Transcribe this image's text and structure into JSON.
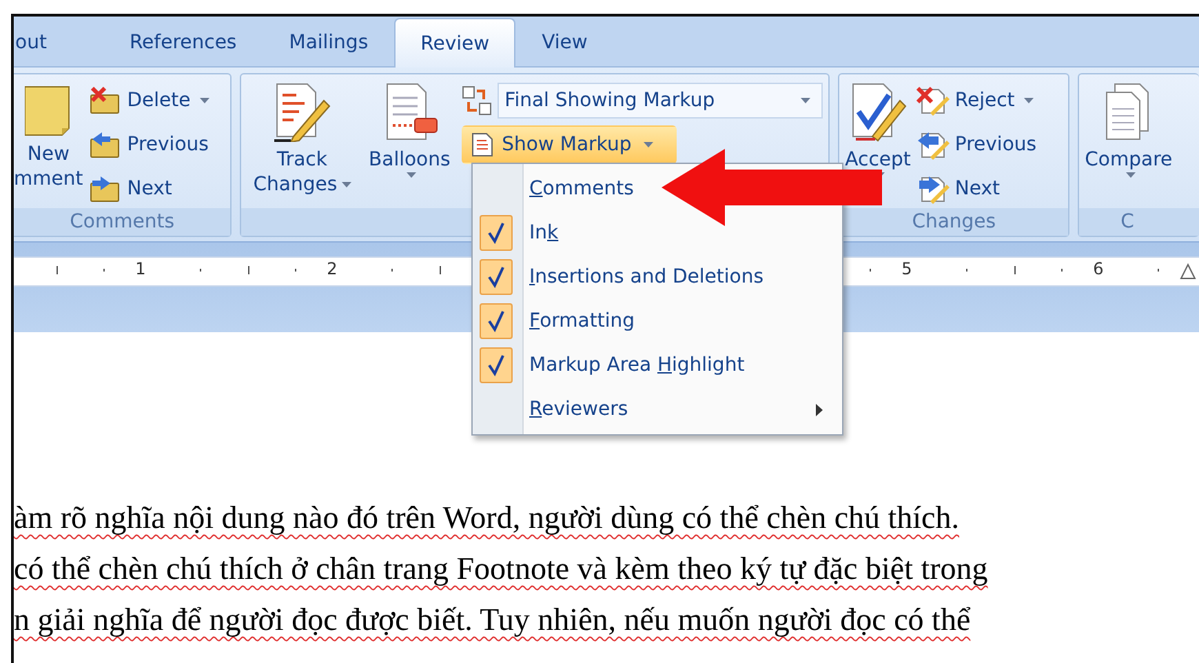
{
  "tabs": [
    {
      "label": "out",
      "selected": false
    },
    {
      "label": "References",
      "selected": false
    },
    {
      "label": "Mailings",
      "selected": false
    },
    {
      "label": "Review",
      "selected": true
    },
    {
      "label": "View",
      "selected": false
    }
  ],
  "comments_group": {
    "label": "Comments",
    "new_comment": {
      "label": "New\nmment"
    },
    "delete": {
      "label": "Delete",
      "dropdown": true
    },
    "previous": {
      "label": "Previous"
    },
    "next": {
      "label": "Next"
    }
  },
  "tracking_group": {
    "track_changes": {
      "label": "Track\nChanges",
      "dropdown": true
    },
    "balloons": {
      "label": "Balloons",
      "dropdown": true
    },
    "display_combo": {
      "value": "Final Showing Markup"
    },
    "show_markup": {
      "label": "Show Markup",
      "dropdown": true,
      "pressed": true
    }
  },
  "changes_group": {
    "label": "Changes",
    "accept": {
      "label": "Accept",
      "dropdown": true
    },
    "reject": {
      "label": "Reject",
      "dropdown": true
    },
    "previous": {
      "label": "Previous"
    },
    "next": {
      "label": "Next"
    }
  },
  "compare_group": {
    "label": "C",
    "compare": {
      "label": "Compare",
      "dropdown": true
    }
  },
  "show_markup_menu": [
    {
      "kind": "check",
      "access_key": "C",
      "after": "omments",
      "checked": false
    },
    {
      "kind": "check",
      "before": "In",
      "access_key": "k",
      "checked": true
    },
    {
      "kind": "check",
      "access_key": "I",
      "after": "nsertions and Deletions",
      "checked": true
    },
    {
      "kind": "check",
      "access_key": "F",
      "after": "ormatting",
      "checked": true
    },
    {
      "kind": "check",
      "before": "Markup Area ",
      "access_key": "H",
      "after": "ighlight",
      "checked": true
    },
    {
      "kind": "submenu",
      "access_key": "R",
      "after": "eviewers"
    }
  ],
  "ruler": {
    "numbers": [
      "1",
      "2",
      "5",
      "6"
    ]
  },
  "document": {
    "lines": [
      "àm rõ nghĩa nội dung nào đó trên Word, người dùng có thể chèn chú thích.",
      "có thể chèn chú thích ở chân trang Footnote và kèm theo ký tự đặc biệt trong",
      "n giải nghĩa để người đọc được biết. Tuy nhiên, nếu muốn người đọc có thể"
    ]
  }
}
